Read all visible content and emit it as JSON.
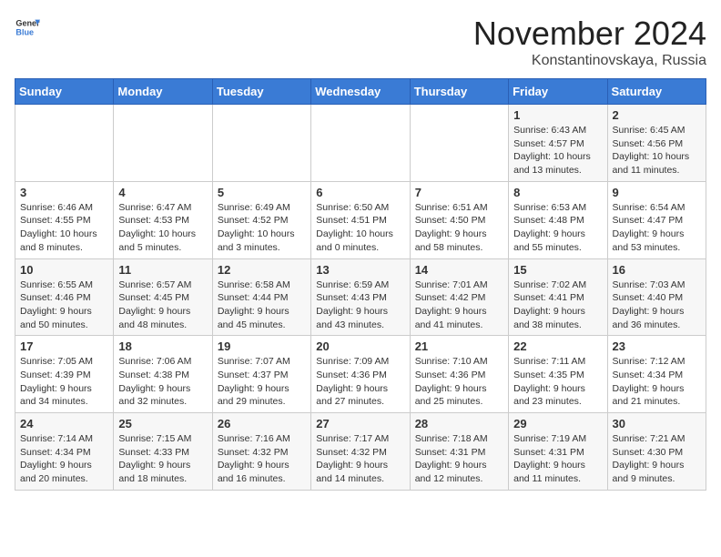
{
  "header": {
    "logo_general": "General",
    "logo_blue": "Blue",
    "month": "November 2024",
    "location": "Konstantinovskaya, Russia"
  },
  "weekdays": [
    "Sunday",
    "Monday",
    "Tuesday",
    "Wednesday",
    "Thursday",
    "Friday",
    "Saturday"
  ],
  "weeks": [
    [
      {
        "day": "",
        "info": ""
      },
      {
        "day": "",
        "info": ""
      },
      {
        "day": "",
        "info": ""
      },
      {
        "day": "",
        "info": ""
      },
      {
        "day": "",
        "info": ""
      },
      {
        "day": "1",
        "info": "Sunrise: 6:43 AM\nSunset: 4:57 PM\nDaylight: 10 hours and 13 minutes."
      },
      {
        "day": "2",
        "info": "Sunrise: 6:45 AM\nSunset: 4:56 PM\nDaylight: 10 hours and 11 minutes."
      }
    ],
    [
      {
        "day": "3",
        "info": "Sunrise: 6:46 AM\nSunset: 4:55 PM\nDaylight: 10 hours and 8 minutes."
      },
      {
        "day": "4",
        "info": "Sunrise: 6:47 AM\nSunset: 4:53 PM\nDaylight: 10 hours and 5 minutes."
      },
      {
        "day": "5",
        "info": "Sunrise: 6:49 AM\nSunset: 4:52 PM\nDaylight: 10 hours and 3 minutes."
      },
      {
        "day": "6",
        "info": "Sunrise: 6:50 AM\nSunset: 4:51 PM\nDaylight: 10 hours and 0 minutes."
      },
      {
        "day": "7",
        "info": "Sunrise: 6:51 AM\nSunset: 4:50 PM\nDaylight: 9 hours and 58 minutes."
      },
      {
        "day": "8",
        "info": "Sunrise: 6:53 AM\nSunset: 4:48 PM\nDaylight: 9 hours and 55 minutes."
      },
      {
        "day": "9",
        "info": "Sunrise: 6:54 AM\nSunset: 4:47 PM\nDaylight: 9 hours and 53 minutes."
      }
    ],
    [
      {
        "day": "10",
        "info": "Sunrise: 6:55 AM\nSunset: 4:46 PM\nDaylight: 9 hours and 50 minutes."
      },
      {
        "day": "11",
        "info": "Sunrise: 6:57 AM\nSunset: 4:45 PM\nDaylight: 9 hours and 48 minutes."
      },
      {
        "day": "12",
        "info": "Sunrise: 6:58 AM\nSunset: 4:44 PM\nDaylight: 9 hours and 45 minutes."
      },
      {
        "day": "13",
        "info": "Sunrise: 6:59 AM\nSunset: 4:43 PM\nDaylight: 9 hours and 43 minutes."
      },
      {
        "day": "14",
        "info": "Sunrise: 7:01 AM\nSunset: 4:42 PM\nDaylight: 9 hours and 41 minutes."
      },
      {
        "day": "15",
        "info": "Sunrise: 7:02 AM\nSunset: 4:41 PM\nDaylight: 9 hours and 38 minutes."
      },
      {
        "day": "16",
        "info": "Sunrise: 7:03 AM\nSunset: 4:40 PM\nDaylight: 9 hours and 36 minutes."
      }
    ],
    [
      {
        "day": "17",
        "info": "Sunrise: 7:05 AM\nSunset: 4:39 PM\nDaylight: 9 hours and 34 minutes."
      },
      {
        "day": "18",
        "info": "Sunrise: 7:06 AM\nSunset: 4:38 PM\nDaylight: 9 hours and 32 minutes."
      },
      {
        "day": "19",
        "info": "Sunrise: 7:07 AM\nSunset: 4:37 PM\nDaylight: 9 hours and 29 minutes."
      },
      {
        "day": "20",
        "info": "Sunrise: 7:09 AM\nSunset: 4:36 PM\nDaylight: 9 hours and 27 minutes."
      },
      {
        "day": "21",
        "info": "Sunrise: 7:10 AM\nSunset: 4:36 PM\nDaylight: 9 hours and 25 minutes."
      },
      {
        "day": "22",
        "info": "Sunrise: 7:11 AM\nSunset: 4:35 PM\nDaylight: 9 hours and 23 minutes."
      },
      {
        "day": "23",
        "info": "Sunrise: 7:12 AM\nSunset: 4:34 PM\nDaylight: 9 hours and 21 minutes."
      }
    ],
    [
      {
        "day": "24",
        "info": "Sunrise: 7:14 AM\nSunset: 4:34 PM\nDaylight: 9 hours and 20 minutes."
      },
      {
        "day": "25",
        "info": "Sunrise: 7:15 AM\nSunset: 4:33 PM\nDaylight: 9 hours and 18 minutes."
      },
      {
        "day": "26",
        "info": "Sunrise: 7:16 AM\nSunset: 4:32 PM\nDaylight: 9 hours and 16 minutes."
      },
      {
        "day": "27",
        "info": "Sunrise: 7:17 AM\nSunset: 4:32 PM\nDaylight: 9 hours and 14 minutes."
      },
      {
        "day": "28",
        "info": "Sunrise: 7:18 AM\nSunset: 4:31 PM\nDaylight: 9 hours and 12 minutes."
      },
      {
        "day": "29",
        "info": "Sunrise: 7:19 AM\nSunset: 4:31 PM\nDaylight: 9 hours and 11 minutes."
      },
      {
        "day": "30",
        "info": "Sunrise: 7:21 AM\nSunset: 4:30 PM\nDaylight: 9 hours and 9 minutes."
      }
    ]
  ]
}
